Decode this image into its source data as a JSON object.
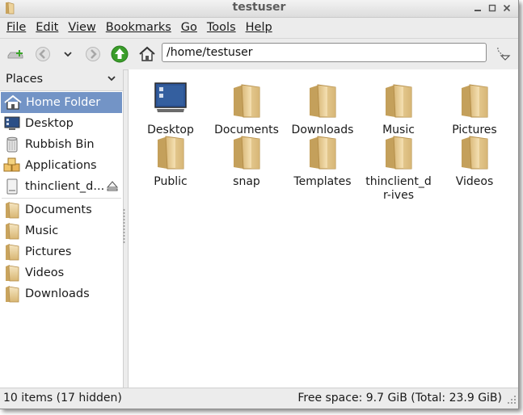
{
  "window": {
    "title": "testuser"
  },
  "menubar": {
    "items": [
      {
        "label": "File"
      },
      {
        "label": "Edit"
      },
      {
        "label": "View"
      },
      {
        "label": "Bookmarks"
      },
      {
        "label": "Go"
      },
      {
        "label": "Tools"
      },
      {
        "label": "Help"
      }
    ]
  },
  "toolbar": {
    "location_value": "/home/testuser",
    "icons": [
      "new-tab-icon",
      "back-icon",
      "history-dropdown-icon",
      "forward-icon",
      "up-icon",
      "home-icon",
      "jump-icon"
    ]
  },
  "sidebar": {
    "header": "Places",
    "items": [
      {
        "label": "Home Folder",
        "icon": "home-icon",
        "selected": true
      },
      {
        "label": "Desktop",
        "icon": "desktop-icon"
      },
      {
        "label": "Rubbish Bin",
        "icon": "trash-icon"
      },
      {
        "label": "Applications",
        "icon": "applications-icon"
      },
      {
        "label": "thinclient_d...",
        "icon": "drive-icon",
        "eject": true
      },
      {
        "label": "Documents",
        "icon": "folder-icon"
      },
      {
        "label": "Music",
        "icon": "folder-icon"
      },
      {
        "label": "Pictures",
        "icon": "folder-icon"
      },
      {
        "label": "Videos",
        "icon": "folder-icon"
      },
      {
        "label": "Downloads",
        "icon": "folder-icon"
      }
    ]
  },
  "files": [
    {
      "label": "Desktop",
      "icon": "desktop-icon"
    },
    {
      "label": "Documents",
      "icon": "folder-icon"
    },
    {
      "label": "Downloads",
      "icon": "folder-icon"
    },
    {
      "label": "Music",
      "icon": "folder-icon"
    },
    {
      "label": "Pictures",
      "icon": "folder-icon"
    },
    {
      "label": "Public",
      "icon": "folder-icon"
    },
    {
      "label": "snap",
      "icon": "folder-icon"
    },
    {
      "label": "Templates",
      "icon": "folder-icon"
    },
    {
      "label": "thinclient_dr-ives",
      "icon": "folder-icon"
    },
    {
      "label": "Videos",
      "icon": "folder-icon"
    }
  ],
  "statusbar": {
    "items_text": "10 items (17 hidden)",
    "free_space_text": "Free space: 9.7 GiB (Total: 23.9 GiB)"
  },
  "colors": {
    "selection": "#7394c6",
    "folder": "#e8c98a",
    "up_green": "#3a9d2a"
  }
}
